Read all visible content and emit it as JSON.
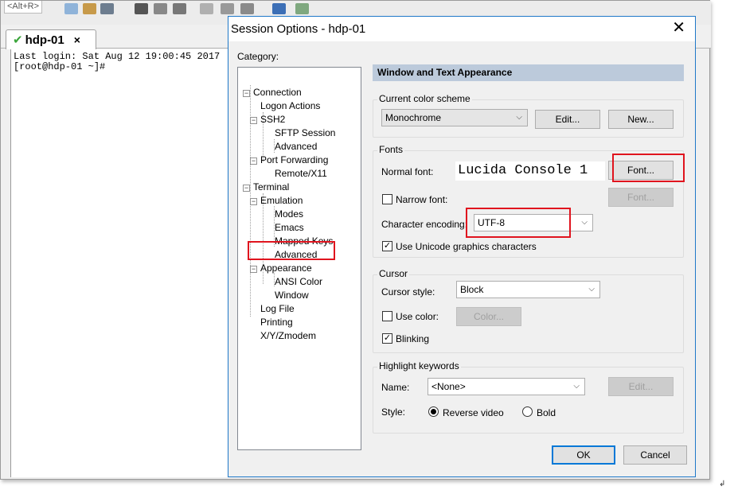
{
  "app": {
    "toolbar_hint": "<Alt+R>",
    "tab_label": "hdp-01",
    "tab_close": "×",
    "terminal_lines": [
      "Last login: Sat Aug 12 19:00:45 2017",
      "[root@hdp-01 ~]#"
    ]
  },
  "dialog": {
    "title": "Session Options - hdp-01",
    "close_glyph": "✕",
    "category_label": "Category:",
    "tree": {
      "connection": "Connection",
      "logon_actions": "Logon Actions",
      "ssh2": "SSH2",
      "sftp_session": "SFTP Session",
      "advanced_ssh": "Advanced",
      "port_forwarding": "Port Forwarding",
      "remote_x11": "Remote/X11",
      "terminal": "Terminal",
      "emulation": "Emulation",
      "modes": "Modes",
      "emacs": "Emacs",
      "mapped_keys": "Mapped Keys",
      "advanced_emu": "Advanced",
      "appearance": "Appearance",
      "ansi_color": "ANSI Color",
      "window": "Window",
      "log_file": "Log File",
      "printing": "Printing",
      "xyzmodem": "X/Y/Zmodem",
      "collapse_glyph": "−"
    },
    "section_header": "Window and Text Appearance",
    "color_scheme": {
      "group_title": "Current color scheme",
      "value": "Monochrome",
      "edit_button": "Edit...",
      "new_button": "New..."
    },
    "fonts": {
      "group_title": "Fonts",
      "normal_font_label": "Normal font:",
      "normal_font_preview": "Lucida Console 1",
      "font_button": "Font...",
      "narrow_font_label": "Narrow font:",
      "narrow_font_button": "Font...",
      "encoding_label": "Character encoding:",
      "encoding_value": "UTF-8",
      "unicode_label": "Use Unicode graphics characters"
    },
    "cursor": {
      "group_title": "Cursor",
      "style_label": "Cursor style:",
      "style_value": "Block",
      "use_color_label": "Use color:",
      "color_button": "Color...",
      "blinking_label": "Blinking"
    },
    "highlight": {
      "group_title": "Highlight keywords",
      "name_label": "Name:",
      "name_value": "<None>",
      "edit_button": "Edit...",
      "style_label": "Style:",
      "reverse_video_label": "Reverse video",
      "bold_label": "Bold"
    },
    "ok_button": "OK",
    "cancel_button": "Cancel",
    "check_glyph": "✓",
    "dropdown_glyph": "⌵"
  },
  "colors": {
    "section_header_bg": "#bccadb",
    "highlight_box": "#e0141e",
    "dialog_border": "#1f78c8"
  },
  "corner_mark": "↲"
}
